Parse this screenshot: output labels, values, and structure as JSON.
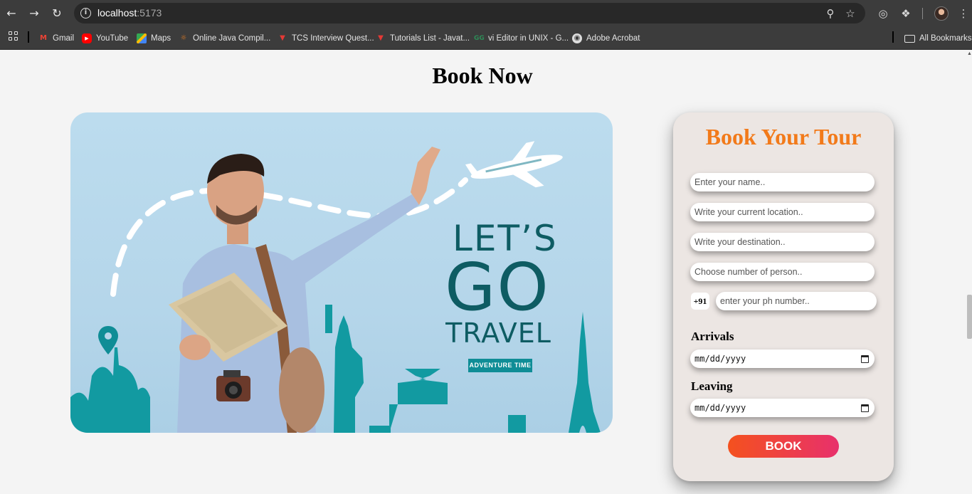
{
  "browser": {
    "url_host": "localhost",
    "url_port": ":5173",
    "bookmarks": [
      {
        "label": "Gmail",
        "color": "#ea4335"
      },
      {
        "label": "YouTube",
        "color": "#ff0000"
      },
      {
        "label": "Maps",
        "color": "#34a853"
      },
      {
        "label": "Online Java Compil...",
        "color": "#e67e22"
      },
      {
        "label": "TCS Interview Quest...",
        "color": "#e53935"
      },
      {
        "label": "Tutorials List - Javat...",
        "color": "#e53935"
      },
      {
        "label": "vi Editor in UNIX - G...",
        "color": "#2e8b57"
      },
      {
        "label": "Adobe Acrobat",
        "color": "#dddddd"
      }
    ],
    "all_bookmarks": "All Bookmarks"
  },
  "page": {
    "title": "Book Now"
  },
  "hero": {
    "lets": "LET’S",
    "go": "GO",
    "travel": "TRAVEL",
    "badge": "ADVENTURE TIME",
    "accent": "#0e5c63",
    "city_color": "#129aa1"
  },
  "form": {
    "title": "Book Your Tour",
    "title_color": "#f27a1a",
    "name_placeholder": "Enter your name..",
    "location_placeholder": "Write your current location..",
    "destination_placeholder": "Write your destination..",
    "persons_placeholder": "Choose number of person..",
    "country_code": "+91",
    "phone_placeholder": "enter your ph number..",
    "arrivals_label": "Arrivals",
    "arrivals_value": "mm/dd/yyyy",
    "leaving_label": "Leaving",
    "leaving_value": "mm/dd/yyyy",
    "book_label": "BOOK"
  }
}
